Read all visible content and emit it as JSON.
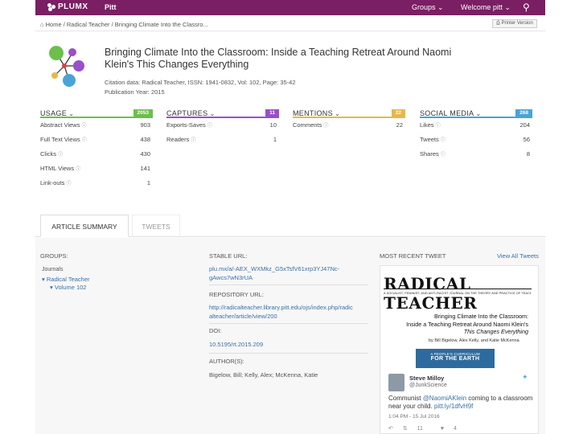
{
  "nav": {
    "logo": "PLUMX",
    "tenant": "Pitt",
    "groups": "Groups",
    "welcome": "Welcome pitt"
  },
  "breadcrumb": "Home / Radical Teacher / Bringing Climate Into the Classro...",
  "print_label": "Printer Version",
  "article": {
    "title": "Bringing Climate Into the Classroom: Inside a Teaching Retreat Around Naomi Klein's This Changes Everything",
    "citation": "Citation data: Radical Teacher, ISSN: 1941-0832, Vol: 102, Page: 35-42",
    "pub_year": "Publication Year: 2015"
  },
  "metrics": {
    "usage": {
      "label": "USAGE",
      "count": "2053",
      "color": "#6cbf4b",
      "rows": [
        {
          "label": "Abstract Views",
          "value": "903"
        },
        {
          "label": "Full Text Views",
          "value": "438"
        },
        {
          "label": "Clicks",
          "value": "430"
        },
        {
          "label": "HTML Views",
          "value": "141"
        },
        {
          "label": "Link-outs",
          "value": "1"
        }
      ]
    },
    "captures": {
      "label": "CAPTURES",
      "count": "11",
      "color": "#9b4fc8",
      "rows": [
        {
          "label": "Exports-Saves",
          "value": "10"
        },
        {
          "label": "Readers",
          "value": "1"
        }
      ]
    },
    "mentions": {
      "label": "MENTIONS",
      "count": "22",
      "color": "#e6b84a",
      "rows": [
        {
          "label": "Comments",
          "value": "22"
        }
      ]
    },
    "social": {
      "label": "SOCIAL MEDIA",
      "count": "268",
      "color": "#4aa3d8",
      "rows": [
        {
          "label": "Likes",
          "value": "204"
        },
        {
          "label": "Tweets",
          "value": "56"
        },
        {
          "label": "Shares",
          "value": "8"
        }
      ]
    }
  },
  "tabs": {
    "summary": "ARTICLE SUMMARY",
    "tweets": "TWEETS"
  },
  "groups": {
    "heading": "GROUPS:",
    "journals": "Journals",
    "journal": "Radical Teacher",
    "volume": "Volume 102"
  },
  "details": {
    "stable_url_label": "STABLE URL:",
    "stable_url_1": "plu.mx/a/-AEX_WXMkz_G5xTsfV61xrp3YJ47Nc-",
    "stable_url_2": "gAwcs7wN3rUA",
    "repository_label": "REPOSITORY URL:",
    "repository_1": "http://radicalteacher.library.pitt.edu/ojs/index.php/radic",
    "repository_2": "alteacher/article/view/200",
    "doi_label": "DOI:",
    "doi": "10.5195/rt.2015.209",
    "authors_label": "AUTHOR(S):",
    "authors": "Bigelow, Bill; Kelly, Alex; McKenna, Katie"
  },
  "tweet": {
    "heading": "MOST RECENT TWEET",
    "view_all": "View All Tweets",
    "card": {
      "brand": "RADICAL TEACHER",
      "brand_sub": "A SOCIALIST, FEMINIST, AND ANTI-RACIST JOURNAL ON THE THEORY AND PRACTICE OF TEACHING",
      "article_line1": "Bringing Climate Into the Classroom:",
      "article_line2": "Inside a Teaching Retreat Around Naomi Klein's",
      "article_line3": "This Changes Everything",
      "authors": "by Bill Bigelow, Alex Kelly, and Katie McKenna",
      "badge_top": "A PEOPLE'S CURRICULUM",
      "badge_bottom": "FOR THE EARTH"
    },
    "name": "Steve Milloy",
    "handle": "@JunkScience",
    "text_prefix": "Communist ",
    "mention": "@NaomiAKlein",
    "text_mid": " coming to a classroom near your child. ",
    "link": "pitt.ly/1dfvH9f",
    "time": "1:04 PM - 15 Jul 2016",
    "retweets": "11",
    "likes": "4"
  }
}
